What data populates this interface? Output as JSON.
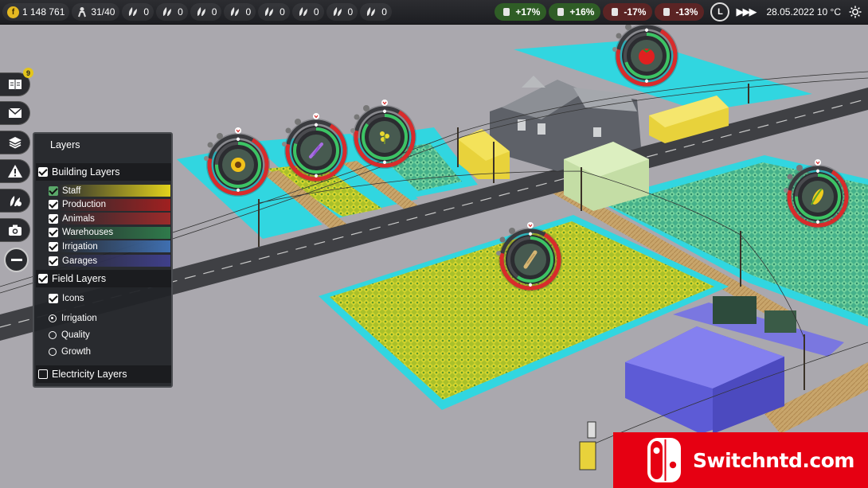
{
  "topbar": {
    "money": "1 148 761",
    "money_icon": "f",
    "workers": "31/40",
    "resources": [
      {
        "value": "0",
        "icon": "seed-icon"
      },
      {
        "value": "0",
        "icon": "seed-icon"
      },
      {
        "value": "0",
        "icon": "seed-icon"
      },
      {
        "value": "0",
        "icon": "seed-icon"
      },
      {
        "value": "0",
        "icon": "seed-icon"
      },
      {
        "value": "0",
        "icon": "seed-icon"
      },
      {
        "value": "0",
        "icon": "seed-icon"
      },
      {
        "value": "0",
        "icon": "seed-icon"
      }
    ],
    "trends": [
      {
        "value": "+17%",
        "icon": "milk-trend-icon",
        "direction": "up",
        "color": "#2f5d26"
      },
      {
        "value": "+16%",
        "icon": "crop-trend-icon",
        "direction": "up",
        "color": "#2f5d26"
      },
      {
        "value": "-17%",
        "icon": "meat-trend-icon",
        "direction": "down",
        "color": "#5b2424"
      },
      {
        "value": "-13%",
        "icon": "wool-trend-icon",
        "direction": "down",
        "color": "#5b2424"
      }
    ],
    "speed_label": "L",
    "fast_forward": "▶▶▶",
    "date": "28.05.2022 10 °C"
  },
  "sidebar": {
    "notification_count": "9",
    "buttons": [
      "book-icon",
      "mail-icon",
      "layers-icon",
      "warning-icon",
      "crops-icon",
      "camera-icon",
      "minus-icon"
    ]
  },
  "layers_panel": {
    "title": "Layers",
    "building_layers": {
      "label": "Building Layers",
      "items": [
        {
          "label": "Staff",
          "checked": true,
          "color": "#e2d21c"
        },
        {
          "label": "Production",
          "checked": true,
          "color": "#a02020"
        },
        {
          "label": "Animals",
          "checked": true,
          "color": "#9c2a2a"
        },
        {
          "label": "Warehouses",
          "checked": true,
          "color": "#2f7a4b"
        },
        {
          "label": "Irrigation",
          "checked": true,
          "color": "#3f6fb0"
        },
        {
          "label": "Garages",
          "checked": true,
          "color": "#3f3f8a"
        }
      ]
    },
    "field_layers": {
      "label": "Field Layers",
      "icons_label": "Icons",
      "options": [
        "Irrigation",
        "Quality",
        "Growth"
      ],
      "selected": "Irrigation"
    },
    "electricity_layers": {
      "label": "Electricity Layers",
      "checked": false
    }
  },
  "field_markers": [
    {
      "icon": "sunflower-icon",
      "progress": 0.75
    },
    {
      "icon": "lavender-icon",
      "progress": 0.8
    },
    {
      "icon": "rapeseed-icon",
      "progress": 0.85
    },
    {
      "icon": "tomato-icon",
      "progress": 0.7
    },
    {
      "icon": "wheat-icon",
      "progress": 0.6
    },
    {
      "icon": "corn-icon",
      "progress": 0.75
    }
  ],
  "watermark": {
    "text": "Switchntd.com",
    "brand_color": "#e60012"
  }
}
